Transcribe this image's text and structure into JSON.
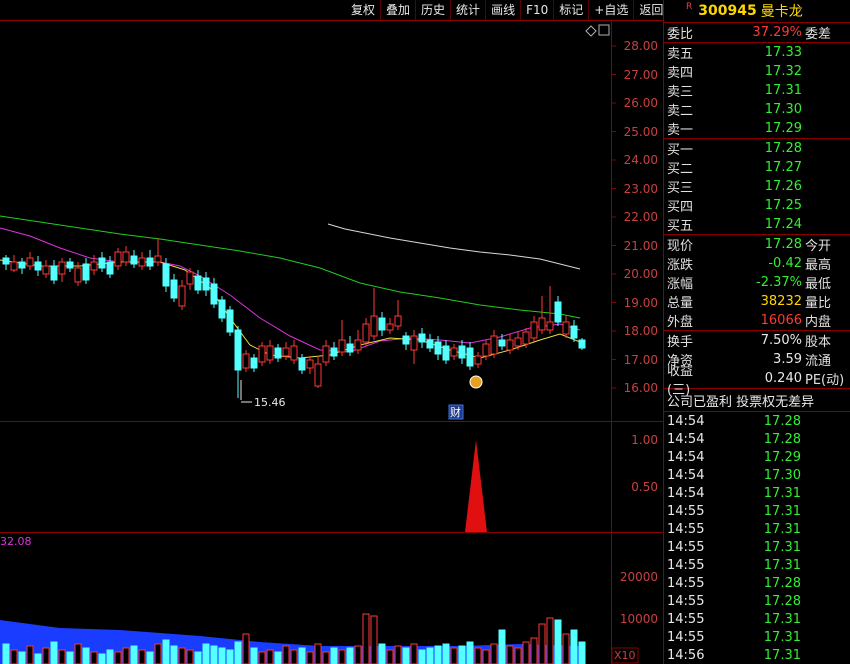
{
  "toolbar": [
    "复权",
    "叠加",
    "历史",
    "统计",
    "画线",
    "F10",
    "标记",
    "+自选",
    "返回"
  ],
  "stock": {
    "mark": "R",
    "code": "300945",
    "name": "曼卡龙"
  },
  "wei": {
    "label": "委比",
    "value": "37.29%",
    "label2": "委差"
  },
  "asks": [
    {
      "label": "卖五",
      "price": "17.33"
    },
    {
      "label": "卖四",
      "price": "17.32"
    },
    {
      "label": "卖三",
      "price": "17.31"
    },
    {
      "label": "卖二",
      "price": "17.30"
    },
    {
      "label": "卖一",
      "price": "17.29"
    }
  ],
  "bids": [
    {
      "label": "买一",
      "price": "17.28"
    },
    {
      "label": "买二",
      "price": "17.27"
    },
    {
      "label": "买三",
      "price": "17.26"
    },
    {
      "label": "买四",
      "price": "17.25"
    },
    {
      "label": "买五",
      "price": "17.24"
    }
  ],
  "stats": [
    {
      "label": "现价",
      "value": "17.28",
      "label2": "今开",
      "color": "green"
    },
    {
      "label": "涨跌",
      "value": "-0.42",
      "label2": "最高",
      "color": "green"
    },
    {
      "label": "涨幅",
      "value": "-2.37%",
      "label2": "最低",
      "color": "green"
    },
    {
      "label": "总量",
      "value": "38232",
      "label2": "量比",
      "color": "yellow"
    },
    {
      "label": "外盘",
      "value": "16066",
      "label2": "内盘",
      "color": "red"
    }
  ],
  "stats2": [
    {
      "label": "换手",
      "value": "7.50%",
      "label2": "股本"
    },
    {
      "label": "净资",
      "value": "3.59",
      "label2": "流通"
    },
    {
      "label": "收益(三)",
      "value": "0.240",
      "label2": "PE(动)"
    }
  ],
  "notice": "公司已盈利 投票权无差异",
  "ticks": [
    {
      "time": "14:54",
      "price": "17.28"
    },
    {
      "time": "14:54",
      "price": "17.28"
    },
    {
      "time": "14:54",
      "price": "17.29"
    },
    {
      "time": "14:54",
      "price": "17.30"
    },
    {
      "time": "14:54",
      "price": "17.31"
    },
    {
      "time": "14:55",
      "price": "17.31"
    },
    {
      "time": "14:55",
      "price": "17.31"
    },
    {
      "time": "14:55",
      "price": "17.31"
    },
    {
      "time": "14:55",
      "price": "17.31"
    },
    {
      "time": "14:55",
      "price": "17.28"
    },
    {
      "time": "14:55",
      "price": "17.28"
    },
    {
      "time": "14:55",
      "price": "17.31"
    },
    {
      "time": "14:55",
      "price": "17.31"
    },
    {
      "time": "14:56",
      "price": "17.31"
    }
  ],
  "chart": {
    "price_axis": [
      "28.00",
      "27.00",
      "26.00",
      "25.00",
      "24.00",
      "23.00",
      "22.00",
      "21.00",
      "20.00",
      "19.00",
      "18.00",
      "17.00",
      "16.00"
    ],
    "low_marker": "15.46",
    "cai_label": "财",
    "sub_axis": [
      "1.00",
      "0.50"
    ],
    "vol_value": "32.08",
    "vol_axis": [
      "20000",
      "10000"
    ],
    "vol_unit": "X10"
  }
}
